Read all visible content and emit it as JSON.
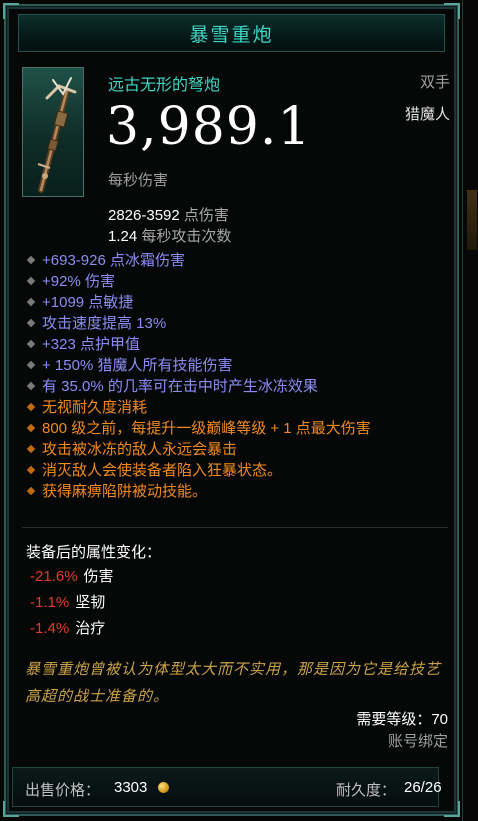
{
  "item": {
    "title": "暴雪重炮",
    "name": "远古无形的弩炮",
    "hand": "双手",
    "class": "猎魔人",
    "dps": "3,989.1",
    "dps_label": "每秒伤害",
    "icon": "crossbow-icon"
  },
  "damage": {
    "range": "2826-3592",
    "range_label": "点伤害",
    "speed": "1.24",
    "speed_label": "每秒攻击次数"
  },
  "affixes": [
    {
      "text": "+693-926 点冰霜伤害",
      "color": "#8c8cf4"
    },
    {
      "text": "+92% 伤害",
      "color": "#8c8cf4"
    },
    {
      "text": "+1099 点敏捷",
      "color": "#8c8cf4"
    },
    {
      "text": "攻击速度提高 13%",
      "color": "#8c8cf4"
    },
    {
      "text": "+323 点护甲值",
      "color": "#8c8cf4"
    },
    {
      "text": "+ 150% 猎魔人所有技能伤害",
      "color": "#8c8cf4"
    },
    {
      "text": "有 35.0% 的几率可在击中时产生冰冻效果",
      "color": "#8c8cf4"
    },
    {
      "text": "无视耐久度消耗",
      "color": "#f08a20"
    },
    {
      "text": "800 级之前，每提升一级巅峰等级 + 1 点最大伤害",
      "color": "#f08a20"
    },
    {
      "text": "攻击被冰冻的敌人永远会暴击",
      "color": "#f08a20"
    },
    {
      "text": "消灭敌人会使装备者陷入狂暴状态。",
      "color": "#f08a20"
    },
    {
      "text": "获得麻痹陷阱被动技能。",
      "color": "#f08a20"
    }
  ],
  "compare": {
    "title": "装备后的属性变化：",
    "rows": [
      {
        "value": "-21.6%",
        "name": "伤害"
      },
      {
        "value": "-1.1%",
        "name": "坚韧"
      },
      {
        "value": "-1.4%",
        "name": "治疗"
      }
    ]
  },
  "flavor": "暴雪重炮曾被认为体型太大而不实用，那是因为它是给技艺高超的战士准备的。",
  "requirements": {
    "level": "需要等级：70",
    "bound": "账号绑定"
  },
  "footer": {
    "sell_label": "出售价格：",
    "sell_value": "3303",
    "durability_label": "耐久度：",
    "durability_value": "26/26"
  },
  "colors": {
    "title": "#3fd6c4",
    "magic_affix": "#8c8cf4",
    "legendary_affix": "#f08a20",
    "negative": "#e23a2a",
    "flavor": "#c9a24a"
  }
}
